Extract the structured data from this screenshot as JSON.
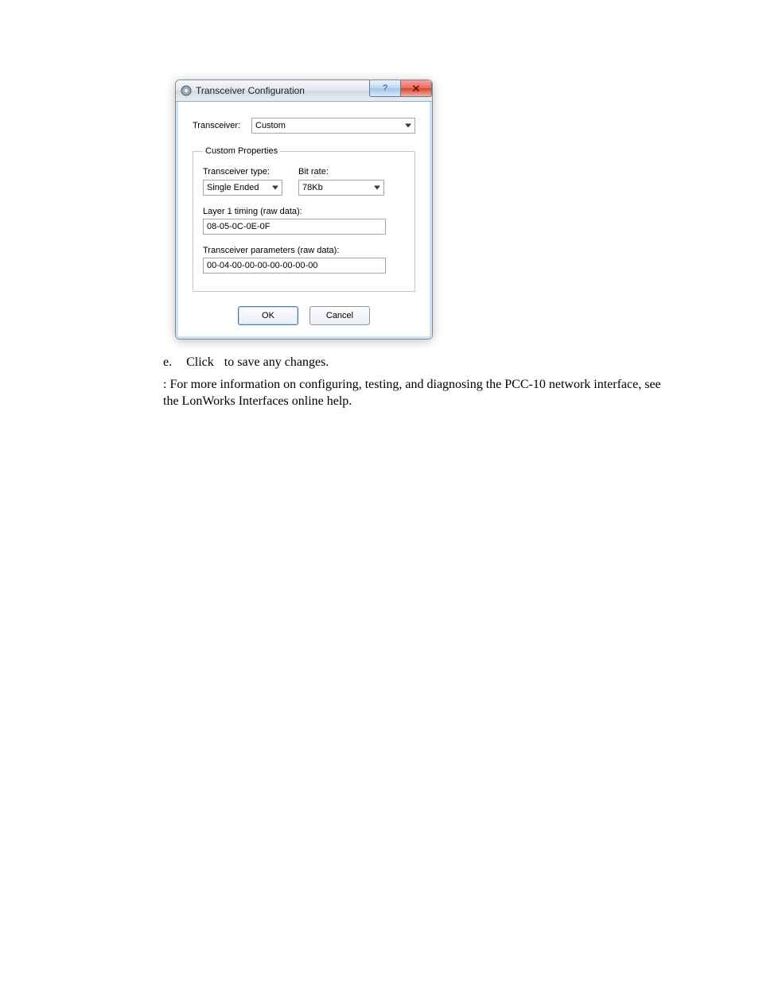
{
  "dialog": {
    "title": "Transceiver Configuration",
    "help_symbol": "?",
    "close_symbol": "✕",
    "transceiver_label": "Transceiver:",
    "transceiver_value": "Custom",
    "fieldset_legend": "Custom Properties",
    "type_label": "Transceiver type:",
    "type_value": "Single Ended",
    "bitrate_label": "Bit rate:",
    "bitrate_value": "78Kb",
    "layer1_label": "Layer 1 timing (raw data):",
    "layer1_value": "08-05-0C-0E-0F",
    "params_label": "Transceiver parameters (raw data):",
    "params_value": "00-04-00-00-00-00-00-00-00",
    "ok_label": "OK",
    "cancel_label": "Cancel"
  },
  "doc": {
    "item_letter": "e.",
    "click_word": "Click",
    "to_save": " to save any changes.",
    "note": ": For more information on configuring, testing, and diagnosing the PCC-10 network interface, see the LonWorks Interfaces online help."
  }
}
